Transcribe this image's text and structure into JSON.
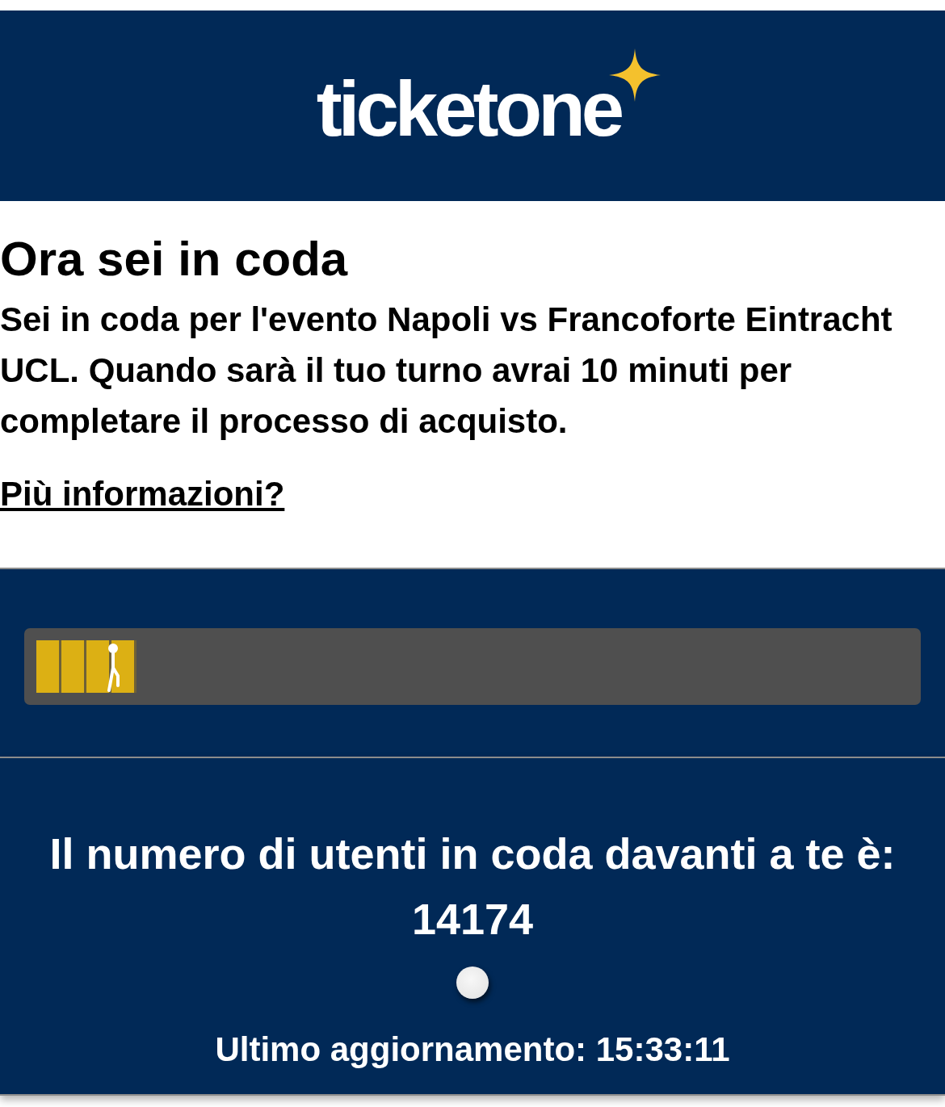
{
  "header": {
    "logo": "ticketone"
  },
  "intro": {
    "title": "Ora sei in coda",
    "message": "Sei in coda per l'evento Napoli vs Francoforte Eintracht UCL. Quando sarà il tuo turno avrai 10 minuti per completare il processo di acquisto.",
    "link": "Più informazioni?"
  },
  "progress": {
    "level": 0.115
  },
  "status": {
    "label": "Il numero di utenti in coda davanti a te è:",
    "count": "14174",
    "last_update": "Ultimo aggiornamento: 15:33:11"
  }
}
